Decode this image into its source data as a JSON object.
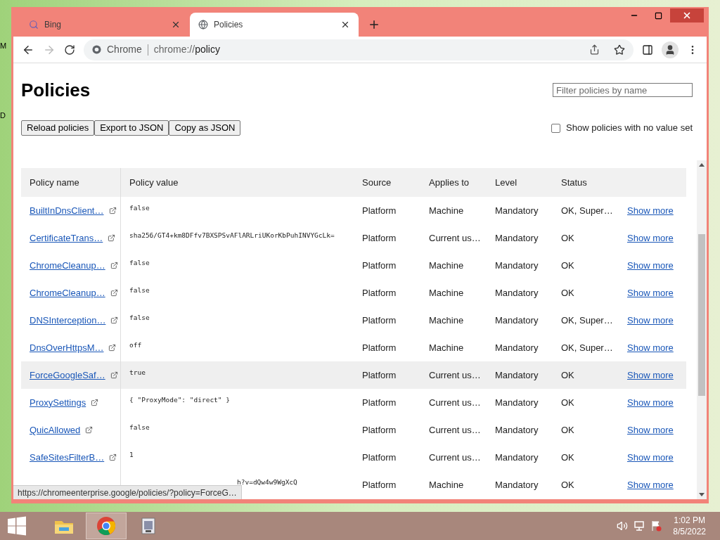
{
  "desktop_labels": [
    "M",
    "D"
  ],
  "tabs": [
    {
      "title": "Bing",
      "selected": false
    },
    {
      "title": "Policies",
      "selected": true
    }
  ],
  "address_bar": {
    "site": "Chrome",
    "url_host": "chrome://",
    "url_path": "policy"
  },
  "page": {
    "title": "Policies",
    "filter": {
      "placeholder": "Filter policies by name"
    },
    "buttons": [
      "Reload policies",
      "Export to JSON",
      "Copy as JSON"
    ],
    "no_value_checkbox": {
      "label": "Show policies with no value set",
      "checked": false
    }
  },
  "table": {
    "columns": [
      "Policy name",
      "Policy value",
      "Source",
      "Applies to",
      "Level",
      "Status"
    ],
    "rows": [
      {
        "name": "BuiltInDnsClient…",
        "value": "false",
        "source": "Platform",
        "applies_to": "Machine",
        "level": "Mandatory",
        "status": "OK, Super…",
        "action": "Show more",
        "hovered": false
      },
      {
        "name": "CertificateTrans…",
        "value": "sha256/GT4+km8DFfv7BXSPSvAFlARLriUKorKbPuhINVYGcLk=",
        "source": "Platform",
        "applies_to": "Current us…",
        "level": "Mandatory",
        "status": "OK",
        "action": "Show more",
        "hovered": false
      },
      {
        "name": "ChromeCleanup…",
        "value": "false",
        "source": "Platform",
        "applies_to": "Machine",
        "level": "Mandatory",
        "status": "OK",
        "action": "Show more",
        "hovered": false
      },
      {
        "name": "ChromeCleanup…",
        "value": "false",
        "source": "Platform",
        "applies_to": "Machine",
        "level": "Mandatory",
        "status": "OK",
        "action": "Show more",
        "hovered": false
      },
      {
        "name": "DNSInterception…",
        "value": "false",
        "source": "Platform",
        "applies_to": "Machine",
        "level": "Mandatory",
        "status": "OK, Super…",
        "action": "Show more",
        "hovered": false
      },
      {
        "name": "DnsOverHttpsM…",
        "value": "off",
        "source": "Platform",
        "applies_to": "Machine",
        "level": "Mandatory",
        "status": "OK, Super…",
        "action": "Show more",
        "hovered": false
      },
      {
        "name": "ForceGoogleSaf…",
        "value": "true",
        "source": "Platform",
        "applies_to": "Current us…",
        "level": "Mandatory",
        "status": "OK",
        "action": "Show more",
        "hovered": true
      },
      {
        "name": "ProxySettings",
        "value": "{ \"ProxyMode\": \"direct\" }",
        "source": "Platform",
        "applies_to": "Current us…",
        "level": "Mandatory",
        "status": "OK",
        "action": "Show more",
        "hovered": false
      },
      {
        "name": "QuicAllowed",
        "value": "false",
        "source": "Platform",
        "applies_to": "Current us…",
        "level": "Mandatory",
        "status": "OK",
        "action": "Show more",
        "hovered": false
      },
      {
        "name": "SafeSitesFilterB…",
        "value": "1",
        "source": "Platform",
        "applies_to": "Current us…",
        "level": "Mandatory",
        "status": "OK",
        "action": "Show more",
        "hovered": false
      },
      {
        "value": "h?v=dQw4w9WgXcQ",
        "source": "Platform",
        "applies_to": "Machine",
        "level": "Mandatory",
        "status": "OK",
        "action": "Show more",
        "hovered": false
      }
    ]
  },
  "status_bubble": "https://chromeenterprise.google/policies/?policy=ForceG…",
  "taskbar": {
    "apps": [
      {
        "selected": false
      },
      {
        "selected": true
      },
      {
        "selected": false
      }
    ],
    "time": "1:02 PM",
    "date": "8/5/2022"
  }
}
